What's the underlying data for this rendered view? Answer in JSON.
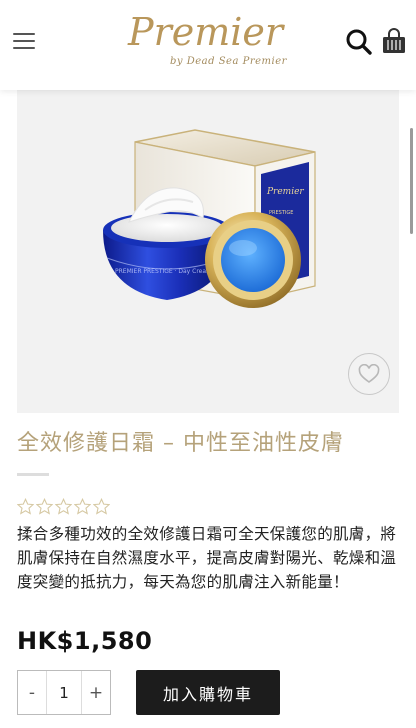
{
  "header": {
    "logo_main": "Premier",
    "logo_sub": "by Dead Sea Premier"
  },
  "product": {
    "title": "全效修護日霜 – 中性至油性皮膚",
    "rating_stars": 0,
    "rating_max": 5,
    "description": "揉合多種功效的全效修護日霜可全天保護您的肌膚，將肌膚保持在自然濕度水平，提高皮膚對陽光、乾燥和溫度突變的抵抗力，每天為您的肌膚注入新能量！",
    "price": "HK$1,580",
    "quantity": "1",
    "qty_minus": "-",
    "qty_plus": "+",
    "add_to_cart": "加入購物車"
  },
  "colors": {
    "accent_gold": "#b9975b",
    "title_color": "#b5a27a",
    "button_bg": "#1c1c1c"
  },
  "icons": [
    "menu-icon",
    "search-icon",
    "cart-icon",
    "heart-icon",
    "star-outline-icon"
  ]
}
